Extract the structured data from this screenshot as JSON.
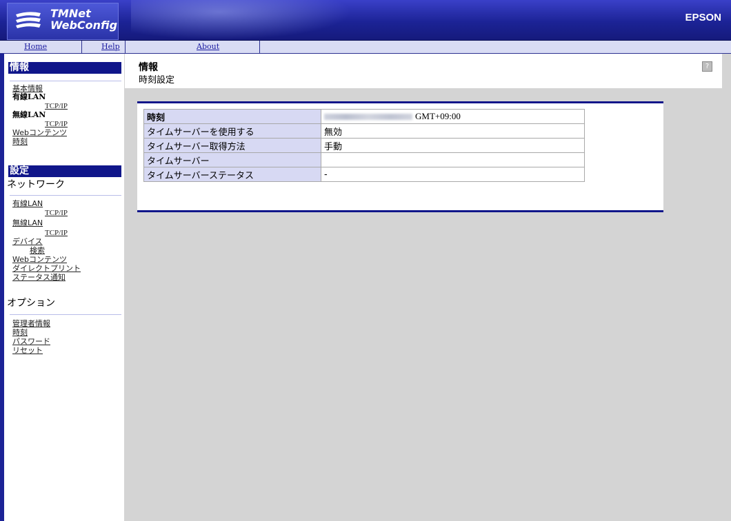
{
  "header": {
    "logo_line1": "TMNet",
    "logo_line2": "WebConfig",
    "brand": "EPSON"
  },
  "nav": {
    "home": "Home",
    "help": "Help",
    "about": "About"
  },
  "sidebar": {
    "info_heading": "情報",
    "info_items": {
      "basic_info": "基本情報",
      "wired_lan": "有線LAN",
      "wired_tcpip": "TCP/IP",
      "wireless_lan": "無線LAN",
      "wireless_tcpip": "TCP/IP",
      "web_contents": "Webコンテンツ",
      "time": "時刻"
    },
    "settings_heading": "設定",
    "network_label": "ネットワーク",
    "network_items": {
      "wired_lan": "有線LAN",
      "wired_tcpip": "TCP/IP",
      "wireless_lan": "無線LAN",
      "wireless_tcpip": "TCP/IP",
      "device": "デバイス",
      "search": "検索",
      "web_contents": "Webコンテンツ",
      "direct_print": "ダイレクトプリント",
      "status_notify": "ステータス通知"
    },
    "options_label": "オプション",
    "option_items": {
      "admin_info": "管理者情報",
      "time": "時刻",
      "password": "パスワード",
      "reset": "リセット"
    }
  },
  "content": {
    "title": "情報",
    "subtitle": "時刻設定",
    "help_icon": "?"
  },
  "table": {
    "rows": [
      {
        "label": "時刻",
        "value": "GMT+09:00"
      },
      {
        "label": "タイムサーバーを使用する",
        "value": "無効"
      },
      {
        "label": "タイムサーバー取得方法",
        "value": "手動"
      },
      {
        "label": "タイムサーバー",
        "value": ""
      },
      {
        "label": "タイムサーバーステータス",
        "value": "-"
      }
    ]
  }
}
